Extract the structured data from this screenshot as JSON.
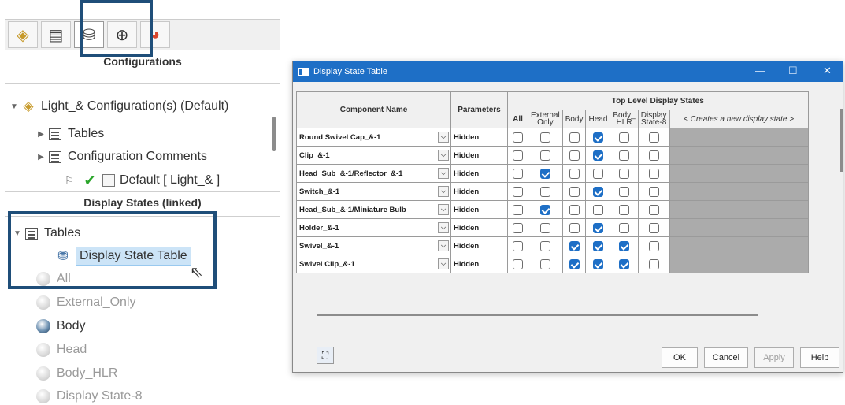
{
  "left_panel": {
    "tabs": [
      {
        "name": "part-icon",
        "glyph": "◈"
      },
      {
        "name": "property-list-icon",
        "glyph": "▤"
      },
      {
        "name": "configuration-manager-icon",
        "glyph": "⛁"
      },
      {
        "name": "dimxpert-icon",
        "glyph": "⊕"
      },
      {
        "name": "display-manager-icon",
        "glyph": "◕"
      }
    ],
    "title": "Configurations",
    "tree": {
      "root_label": "Light_& Configuration(s)  (Default)",
      "tables_label": "Tables",
      "comments_label": "Configuration Comments",
      "default_config_label": "Default [ Light_& ]"
    },
    "section_title": "Display States (linked)",
    "display_tree": {
      "tables_label": "Tables",
      "dst_label": "Display State Table"
    },
    "display_states": [
      "All",
      "External_Only",
      "Body",
      "Head",
      "Body_HLR",
      "Display State-8"
    ]
  },
  "dialog": {
    "title": "Display State Table",
    "headers": {
      "component": "Component Name",
      "parameters": "Parameters",
      "top_level": "Top Level Display States",
      "cols": [
        "All",
        "External Only",
        "Body",
        "Head",
        "Body_ HLR",
        "Display State-8"
      ],
      "new_state": "< Creates a new display state >"
    },
    "rows": [
      {
        "name": "Round Swivel Cap_&-1",
        "param": "Hidden",
        "checks": [
          false,
          false,
          false,
          true,
          false,
          false
        ]
      },
      {
        "name": "Clip_&-1",
        "param": "Hidden",
        "checks": [
          false,
          false,
          false,
          true,
          false,
          false
        ]
      },
      {
        "name": "Head_Sub_&-1/Reflector_&-1",
        "param": "Hidden",
        "checks": [
          false,
          true,
          false,
          false,
          false,
          false
        ]
      },
      {
        "name": "Switch_&-1",
        "param": "Hidden",
        "checks": [
          false,
          false,
          false,
          true,
          false,
          false
        ]
      },
      {
        "name": "Head_Sub_&-1/Miniature Bulb",
        "param": "Hidden",
        "checks": [
          false,
          true,
          false,
          false,
          false,
          false
        ]
      },
      {
        "name": "Holder_&-1",
        "param": "Hidden",
        "checks": [
          false,
          false,
          false,
          true,
          false,
          false
        ]
      },
      {
        "name": "Swivel_&-1",
        "param": "Hidden",
        "checks": [
          false,
          false,
          true,
          true,
          true,
          false
        ]
      },
      {
        "name": "Swivel Clip_&-1",
        "param": "Hidden",
        "checks": [
          false,
          false,
          true,
          true,
          true,
          false
        ]
      }
    ],
    "buttons": {
      "ok": "OK",
      "cancel": "Cancel",
      "apply": "Apply",
      "help": "Help"
    }
  },
  "colors": {
    "accent": "#1e6fc6",
    "highlight_box": "#1f4e79"
  }
}
